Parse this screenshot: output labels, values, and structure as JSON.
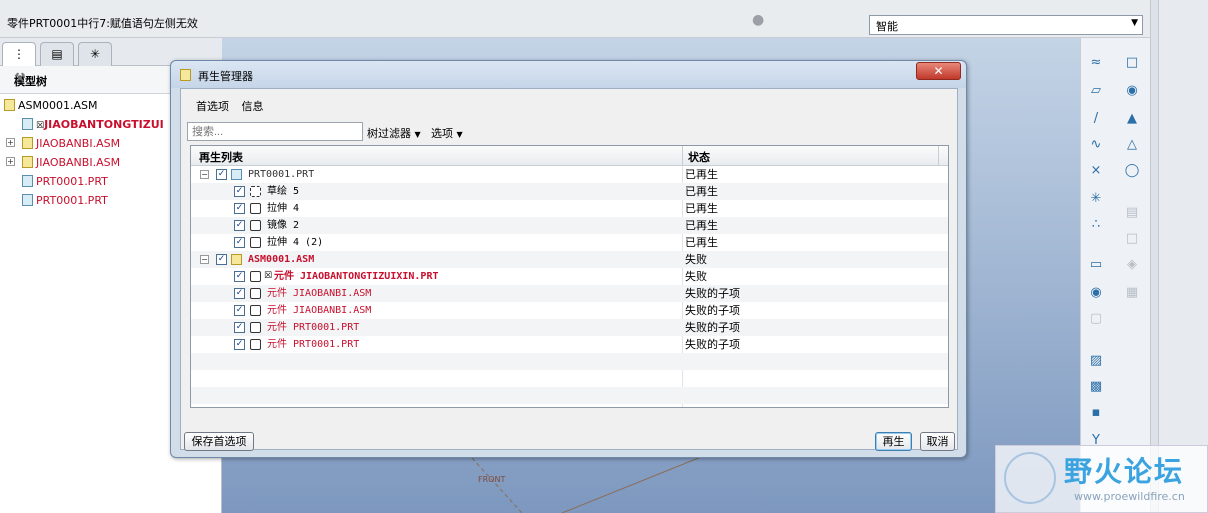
{
  "topbar": {
    "message": "零件PRT0001中行7:赋值语句左侧无效",
    "filter_value": "智能"
  },
  "model_tree": {
    "header": "模型树",
    "items": [
      {
        "label": "ASM0001.ASM",
        "color": "normal"
      },
      {
        "label": "JIAOBANTONGTIZUI",
        "color": "red"
      },
      {
        "label": "JIAOBANBI.ASM",
        "color": "red"
      },
      {
        "label": "JIAOBANBI.ASM",
        "color": "red"
      },
      {
        "label": "PRT0001.PRT",
        "color": "red"
      },
      {
        "label": "PRT0001.PRT",
        "color": "red"
      }
    ]
  },
  "canvas": {
    "front_label": "FRONT"
  },
  "dialog": {
    "title": "再生管理器",
    "close_label": "✕",
    "menu": [
      "首选项",
      "信息"
    ],
    "search_placeholder": "搜索...",
    "tree_filter": "树过滤器",
    "options": "选项",
    "col_list": "再生列表",
    "col_status": "状态",
    "rows": [
      {
        "name": "PRT0001.PRT",
        "status": "已再生"
      },
      {
        "name": "草绘 5",
        "status": "已再生"
      },
      {
        "name": "拉伸 4",
        "status": "已再生"
      },
      {
        "name": "镜像 2",
        "status": "已再生"
      },
      {
        "name": "拉伸 4 (2)",
        "status": "已再生"
      },
      {
        "name": "ASM0001.ASM",
        "status": "失败"
      },
      {
        "name": "元件 JIAOBANTONGTIZUIXIN.PRT",
        "status": "失败"
      },
      {
        "name": "元件 JIAOBANBI.ASM",
        "status": "失败的子项"
      },
      {
        "name": "元件 JIAOBANBI.ASM",
        "status": "失败的子项"
      },
      {
        "name": "元件 PRT0001.PRT",
        "status": "失败的子项"
      },
      {
        "name": "元件 PRT0001.PRT",
        "status": "失败的子项"
      }
    ],
    "save_prefs": "保存首选项",
    "regenerate": "再生",
    "cancel": "取消"
  },
  "watermark": {
    "text": "野火论坛",
    "url": "www.proewildfire.cn"
  }
}
